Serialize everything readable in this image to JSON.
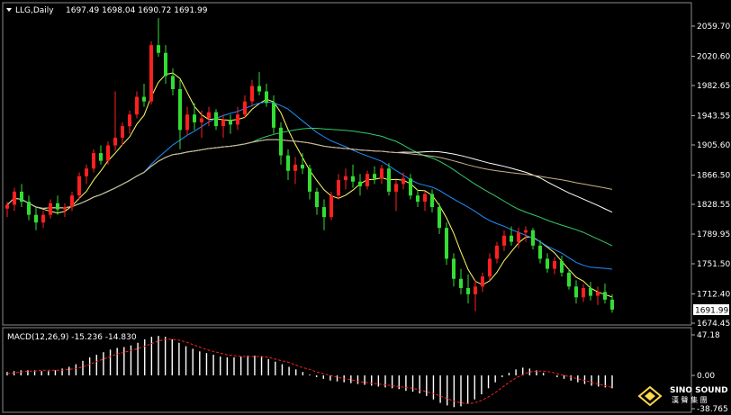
{
  "header": {
    "symbol_timeframe": "LLG,Daily",
    "ohlc": "1697.49 1698.04 1690.72 1691.99"
  },
  "macd_panel": {
    "label": "MACD(12,26,9) -15.236 -14.830"
  },
  "logo": {
    "brand": "SINO SOUND",
    "chinese": "漢 聲 集 團"
  },
  "colors": {
    "background": "#000000",
    "up_candle": "#ff2020",
    "down_candle": "#33dd33",
    "ma_fast": "#ffff66",
    "ma_mid": "#1e90ff",
    "ma_slow": "#33cc66",
    "ma_slower": "#ffffff",
    "ma_slowest": "#c8b28a",
    "macd_hist": "#ffffff",
    "macd_signal": "#ff2020"
  },
  "chart_data": [
    {
      "type": "candlestick",
      "y_ticks": [
        "2059.70",
        "2020.60",
        "1982.65",
        "1943.55",
        "1905.60",
        "1866.50",
        "1828.55",
        "1789.95",
        "1751.50",
        "1712.40",
        "1674.45"
      ],
      "current_price": "1691.99",
      "ylim": [
        1674.45,
        2075
      ],
      "candles": [
        [
          1823,
          1832,
          1812,
          1828
        ],
        [
          1828,
          1850,
          1820,
          1845
        ],
        [
          1845,
          1855,
          1825,
          1832
        ],
        [
          1832,
          1840,
          1808,
          1815
        ],
        [
          1815,
          1825,
          1795,
          1805
        ],
        [
          1805,
          1820,
          1798,
          1815
        ],
        [
          1815,
          1835,
          1810,
          1830
        ],
        [
          1830,
          1840,
          1815,
          1822
        ],
        [
          1822,
          1830,
          1812,
          1825
        ],
        [
          1825,
          1845,
          1820,
          1840
        ],
        [
          1840,
          1870,
          1835,
          1865
        ],
        [
          1865,
          1880,
          1855,
          1875
        ],
        [
          1875,
          1900,
          1870,
          1895
        ],
        [
          1895,
          1905,
          1880,
          1885
        ],
        [
          1885,
          1910,
          1880,
          1905
        ],
        [
          1905,
          1975,
          1898,
          1915
        ],
        [
          1915,
          1935,
          1905,
          1930
        ],
        [
          1930,
          1950,
          1920,
          1945
        ],
        [
          1945,
          1975,
          1940,
          1968
        ],
        [
          1968,
          1985,
          1955,
          1962
        ],
        [
          1962,
          2040,
          1958,
          2035
        ],
        [
          2035,
          2070,
          2020,
          2025
        ],
        [
          2025,
          2035,
          1985,
          1995
        ],
        [
          1995,
          2005,
          1970,
          1978
        ],
        [
          1978,
          1990,
          1900,
          1925
        ],
        [
          1925,
          1955,
          1918,
          1945
        ],
        [
          1945,
          1960,
          1925,
          1935
        ],
        [
          1935,
          1950,
          1915,
          1940
        ],
        [
          1940,
          1955,
          1930,
          1948
        ],
        [
          1948,
          1952,
          1925,
          1930
        ],
        [
          1930,
          1945,
          1915,
          1938
        ],
        [
          1938,
          1945,
          1920,
          1932
        ],
        [
          1932,
          1955,
          1925,
          1945
        ],
        [
          1945,
          1970,
          1940,
          1962
        ],
        [
          1962,
          1990,
          1955,
          1982
        ],
        [
          1982,
          2000,
          1970,
          1975
        ],
        [
          1975,
          1985,
          1955,
          1960
        ],
        [
          1960,
          1970,
          1920,
          1928
        ],
        [
          1928,
          1935,
          1880,
          1892
        ],
        [
          1892,
          1900,
          1860,
          1872
        ],
        [
          1872,
          1890,
          1855,
          1880
        ],
        [
          1880,
          1895,
          1868,
          1875
        ],
        [
          1875,
          1880,
          1835,
          1845
        ],
        [
          1845,
          1850,
          1815,
          1825
        ],
        [
          1825,
          1835,
          1795,
          1812
        ],
        [
          1812,
          1845,
          1808,
          1840
        ],
        [
          1840,
          1868,
          1835,
          1860
        ],
        [
          1860,
          1875,
          1848,
          1865
        ],
        [
          1865,
          1880,
          1850,
          1858
        ],
        [
          1858,
          1868,
          1840,
          1852
        ],
        [
          1852,
          1872,
          1848,
          1868
        ],
        [
          1868,
          1878,
          1855,
          1862
        ],
        [
          1862,
          1880,
          1855,
          1875
        ],
        [
          1875,
          1882,
          1840,
          1845
        ],
        [
          1845,
          1860,
          1820,
          1855
        ],
        [
          1855,
          1870,
          1848,
          1862
        ],
        [
          1862,
          1868,
          1835,
          1840
        ],
        [
          1840,
          1848,
          1825,
          1832
        ],
        [
          1832,
          1845,
          1820,
          1842
        ],
        [
          1842,
          1848,
          1818,
          1825
        ],
        [
          1825,
          1830,
          1790,
          1798
        ],
        [
          1798,
          1805,
          1750,
          1758
        ],
        [
          1758,
          1765,
          1722,
          1732
        ],
        [
          1732,
          1745,
          1712,
          1720
        ],
        [
          1720,
          1738,
          1700,
          1712
        ],
        [
          1712,
          1730,
          1690,
          1722
        ],
        [
          1722,
          1740,
          1715,
          1735
        ],
        [
          1735,
          1765,
          1730,
          1758
        ],
        [
          1758,
          1780,
          1752,
          1775
        ],
        [
          1775,
          1795,
          1768,
          1788
        ],
        [
          1788,
          1800,
          1775,
          1780
        ],
        [
          1780,
          1798,
          1772,
          1792
        ],
        [
          1792,
          1800,
          1780,
          1795
        ],
        [
          1795,
          1798,
          1770,
          1775
        ],
        [
          1775,
          1782,
          1752,
          1758
        ],
        [
          1758,
          1765,
          1740,
          1745
        ],
        [
          1745,
          1760,
          1738,
          1755
        ],
        [
          1755,
          1762,
          1735,
          1740
        ],
        [
          1740,
          1745,
          1718,
          1722
        ],
        [
          1722,
          1730,
          1700,
          1708
        ],
        [
          1708,
          1725,
          1702,
          1720
        ],
        [
          1720,
          1728,
          1704,
          1710
        ],
        [
          1710,
          1722,
          1698,
          1715
        ],
        [
          1715,
          1726,
          1700,
          1705
        ],
        [
          1705,
          1712,
          1688,
          1692
        ]
      ]
    },
    {
      "type": "macd",
      "title": "MACD(12,26,9) -15.236 -14.830",
      "y_ticks": [
        "47.18",
        "0.00",
        "-38.765"
      ],
      "ylim": [
        -38.765,
        47.18
      ],
      "histogram": [
        4,
        5,
        6,
        6,
        6,
        5,
        5,
        6,
        8,
        10,
        13,
        17,
        21,
        24,
        27,
        30,
        32,
        33,
        35,
        38,
        42,
        45,
        46,
        45,
        42,
        38,
        34,
        31,
        28,
        26,
        24,
        22,
        21,
        21,
        22,
        23,
        23,
        22,
        19,
        16,
        13,
        10,
        7,
        4,
        1,
        -2,
        -4,
        -6,
        -7,
        -8,
        -9,
        -10,
        -11,
        -12,
        -13,
        -14,
        -15,
        -16,
        -18,
        -19,
        -21,
        -24,
        -28,
        -32,
        -35,
        -37,
        -36,
        -33,
        -28,
        -22,
        -15,
        -8,
        -2,
        3,
        7,
        9,
        8,
        6,
        3,
        0,
        -2,
        -4,
        -6,
        -8,
        -10,
        -12,
        -13,
        -14,
        -15
      ],
      "signal": [
        2,
        3,
        4,
        5,
        5,
        6,
        6,
        6,
        6,
        7,
        8,
        10,
        13,
        16,
        19,
        22,
        25,
        27,
        29,
        31,
        34,
        37,
        40,
        42,
        42,
        41,
        39,
        36,
        33,
        30,
        28,
        26,
        24,
        23,
        22,
        22,
        22,
        22,
        21,
        19,
        17,
        15,
        12,
        9,
        7,
        4,
        2,
        0,
        -2,
        -4,
        -5,
        -7,
        -8,
        -9,
        -10,
        -11,
        -12,
        -13,
        -14,
        -15,
        -17,
        -19,
        -21,
        -24,
        -27,
        -30,
        -32,
        -33,
        -32,
        -29,
        -25,
        -20,
        -14,
        -8,
        -3,
        1,
        4,
        5,
        5,
        4,
        2,
        0,
        -2,
        -4,
        -6,
        -8,
        -10,
        -12,
        -14
      ]
    }
  ]
}
